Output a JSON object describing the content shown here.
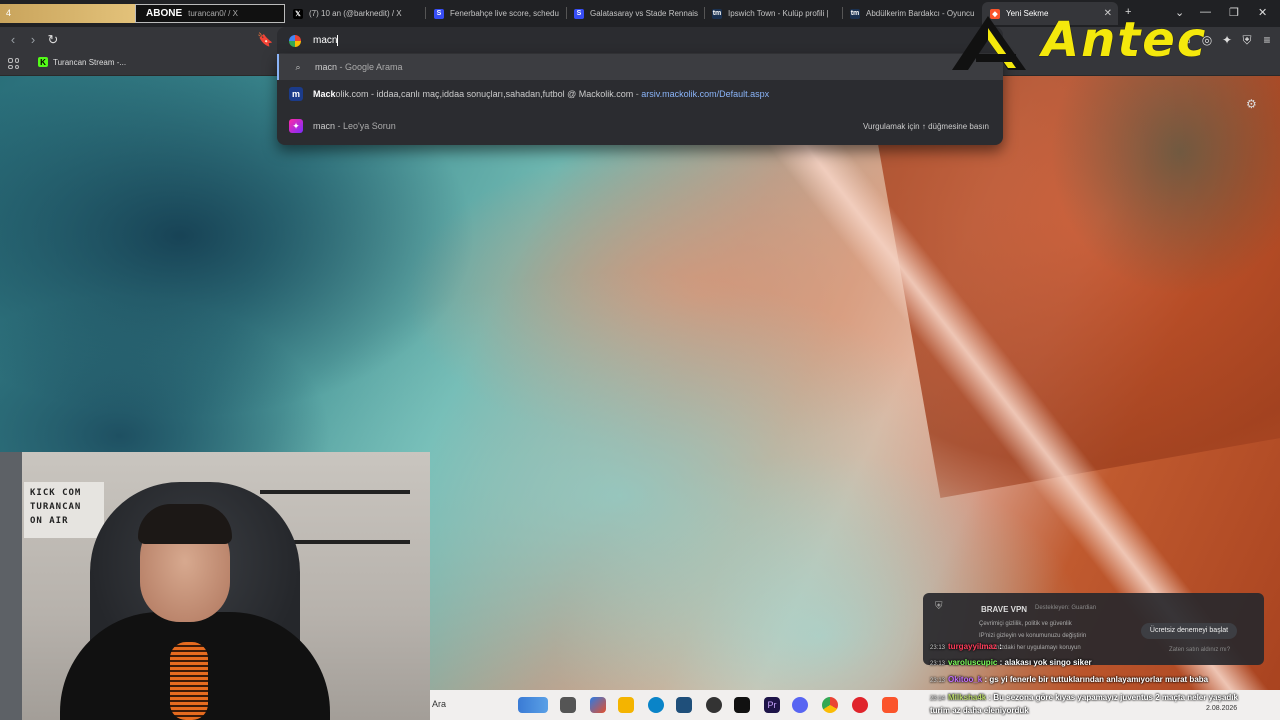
{
  "stream": {
    "banner_left": "4",
    "banner_abone": "ABONE",
    "banner_sub": "turancan0/ / X"
  },
  "tabs": [
    {
      "label": "(7) 10 an (@barknedit) / X",
      "icon": "x-logo-icon"
    },
    {
      "label": "Fenerbahçe live score, schedu",
      "icon": "sofascore-icon"
    },
    {
      "label": "Galatasaray vs Stade Rennais",
      "icon": "sofascore-icon"
    },
    {
      "label": "Ipswich Town - Kulüp profili |",
      "icon": "transfermarkt-icon"
    },
    {
      "label": "Abdülkerim Bardakcı - Oyuncu",
      "icon": "transfermarkt-icon"
    },
    {
      "label": "Yeni Sekme",
      "icon": "brave-icon",
      "active": true
    }
  ],
  "omnibox": {
    "query": "macn"
  },
  "bookmarks": [
    {
      "label": "Turancan Stream -...",
      "icon": "kick-icon"
    }
  ],
  "suggestions": [
    {
      "icon": "search-icon",
      "bold": "",
      "text": "macn",
      "dim": " - Google Arama",
      "selected": true
    },
    {
      "icon": "mackolik-icon",
      "bold": "Mack",
      "text": "olik.com - iddaa,canlı maç,iddaa sonuçları,sahadan,futbol @ Mackolik.com",
      "dim": " - ",
      "url": "arsiv.mackolik.com/Default.aspx"
    },
    {
      "icon": "leo-icon",
      "bold": "",
      "text": "macn",
      "dim": " - Leo'ya Sorun",
      "hint": "Vurgulamak için ↑ düğmesine basın"
    }
  ],
  "overlay": {
    "brand": "Antec",
    "webcam_sign": [
      "KICK COM",
      "TURANCAN",
      "ON AIR"
    ]
  },
  "vpn": {
    "title": "BRAVE VPN",
    "subtitle": "Destekleyen: Guardian",
    "lines": [
      "Çevrimiçi gizlilik, politik ve güvenlik",
      "IP'nizi gizleyin ve konumunuzu değiştirin",
      "Cihazınızdaki her uygulamayı koruyun"
    ],
    "button": "Ücretsiz denemeyi başlat",
    "link": "Zaten satın aldınız mı?"
  },
  "chat": [
    {
      "time": "23:13",
      "user": "turgayyilmaz",
      "user_class": "u1",
      "msg": ":"
    },
    {
      "time": "23:13",
      "user": "varoluscupic",
      "user_class": "u2",
      "msg": ": alakası yok singo siker"
    },
    {
      "time": "23:13",
      "user": "Okitoo_k",
      "user_class": "u3",
      "msg": ": gs yi fenerle bir tuttuklarından anlayamıyorlar murat baba"
    },
    {
      "time": "23:14",
      "user": "Milksha4k",
      "user_class": "u4",
      "msg": ": Bu sezona göre kıyas yapamayız juventus 2 maçta neler yaşadık turim az daha eleniyorduk"
    }
  ],
  "taskbar": {
    "search": "Ara",
    "date": "2.08.2026"
  },
  "colors": {
    "accent": "#8ab4f8",
    "antec_yellow": "#f4e80c",
    "kick_green": "#53fc18"
  }
}
